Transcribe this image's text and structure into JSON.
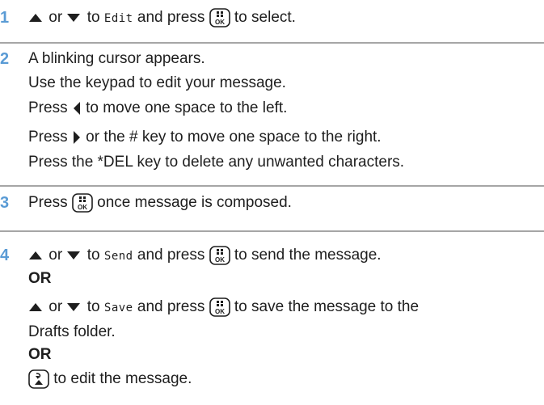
{
  "steps": [
    {
      "number": "1",
      "lines": {
        "l1": {
          "t1": "or",
          "t2": "to",
          "menu": "Edit",
          "t3": "and press",
          "t4": "to select."
        }
      }
    },
    {
      "number": "2",
      "lines": {
        "l1": "A blinking cursor appears.",
        "l2": "Use the keypad to edit your message.",
        "l3": {
          "t1": "Press",
          "t2": "to move one space to the left."
        },
        "l4": {
          "t1": "Press",
          "t2": "or the # key to move one space to the right."
        },
        "l5": "Press the *DEL key to delete any unwanted characters."
      }
    },
    {
      "number": "3",
      "lines": {
        "l1": {
          "t1": "Press",
          "t2": "once message is composed."
        }
      }
    },
    {
      "number": "4",
      "lines": {
        "l1": {
          "t1": "or",
          "t2": "to",
          "menu": "Send",
          "t3": "and press",
          "t4": "to send the message."
        },
        "or1": "OR",
        "l2": {
          "t1": "or",
          "t2": "to",
          "menu": "Save",
          "t3": "and press",
          "t4": "to save the message to the"
        },
        "l3": "Drafts folder.",
        "or2": "OR",
        "l4": {
          "t1": "to edit the message."
        }
      }
    }
  ],
  "icons": {
    "up": "up-arrow-icon",
    "down": "down-arrow-icon",
    "left": "left-arrow-icon",
    "right": "right-arrow-icon",
    "ok": "ok-key-icon",
    "back": "back-key-icon"
  },
  "colors": {
    "step_number": "#5a9bd5",
    "rule": "#a6a6a6",
    "text": "#1e1e1e"
  }
}
